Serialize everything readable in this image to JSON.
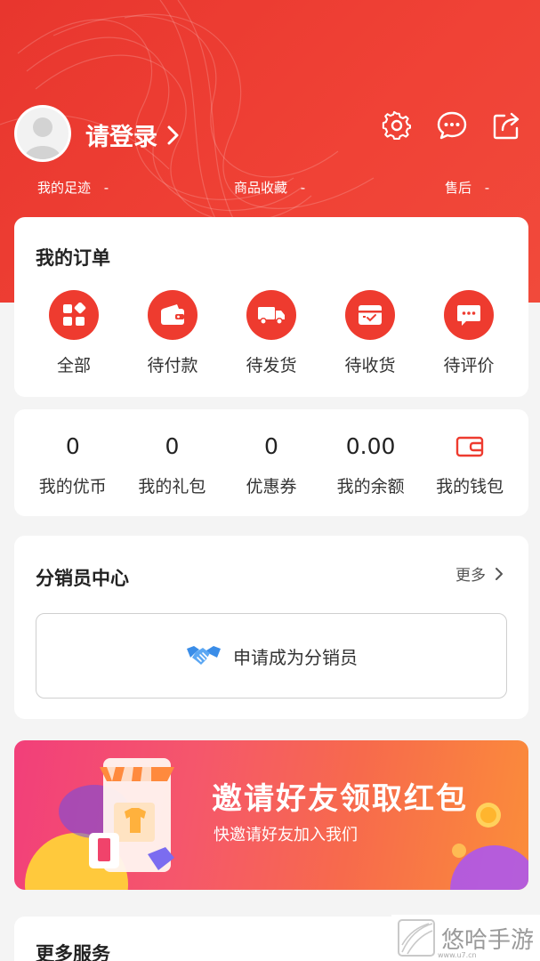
{
  "header": {
    "login_text": "请登录",
    "stats": [
      {
        "label": "我的足迹",
        "value": "-"
      },
      {
        "label": "商品收藏",
        "value": "-"
      },
      {
        "label": "售后",
        "value": "-"
      }
    ],
    "icons": [
      "settings-icon",
      "message-icon",
      "share-icon"
    ]
  },
  "orders": {
    "title": "我的订单",
    "items": [
      {
        "label": "全部",
        "icon": "grid-icon"
      },
      {
        "label": "待付款",
        "icon": "wallet-icon"
      },
      {
        "label": "待发货",
        "icon": "truck-icon"
      },
      {
        "label": "待收货",
        "icon": "inbox-icon"
      },
      {
        "label": "待评价",
        "icon": "comment-icon"
      }
    ]
  },
  "wallet": {
    "items": [
      {
        "value": "0",
        "label": "我的优币"
      },
      {
        "value": "0",
        "label": "我的礼包"
      },
      {
        "value": "0",
        "label": "优惠券"
      },
      {
        "value": "0.00",
        "label": "我的余额"
      },
      {
        "label": "我的钱包",
        "icon": "wallet-outline-icon"
      }
    ]
  },
  "distributor": {
    "title": "分销员中心",
    "more_label": "更多",
    "apply_label": "申请成为分销员"
  },
  "banner": {
    "title": "邀请好友领取红包",
    "subtitle": "快邀请好友加入我们"
  },
  "more_services": {
    "title": "更多服务"
  },
  "watermark": {
    "text": "悠哈手游",
    "url": "www.u7.cn"
  },
  "colors": {
    "accent": "#ee3b2f",
    "banner_start": "#f23f7a",
    "banner_end": "#fb8d3a"
  }
}
